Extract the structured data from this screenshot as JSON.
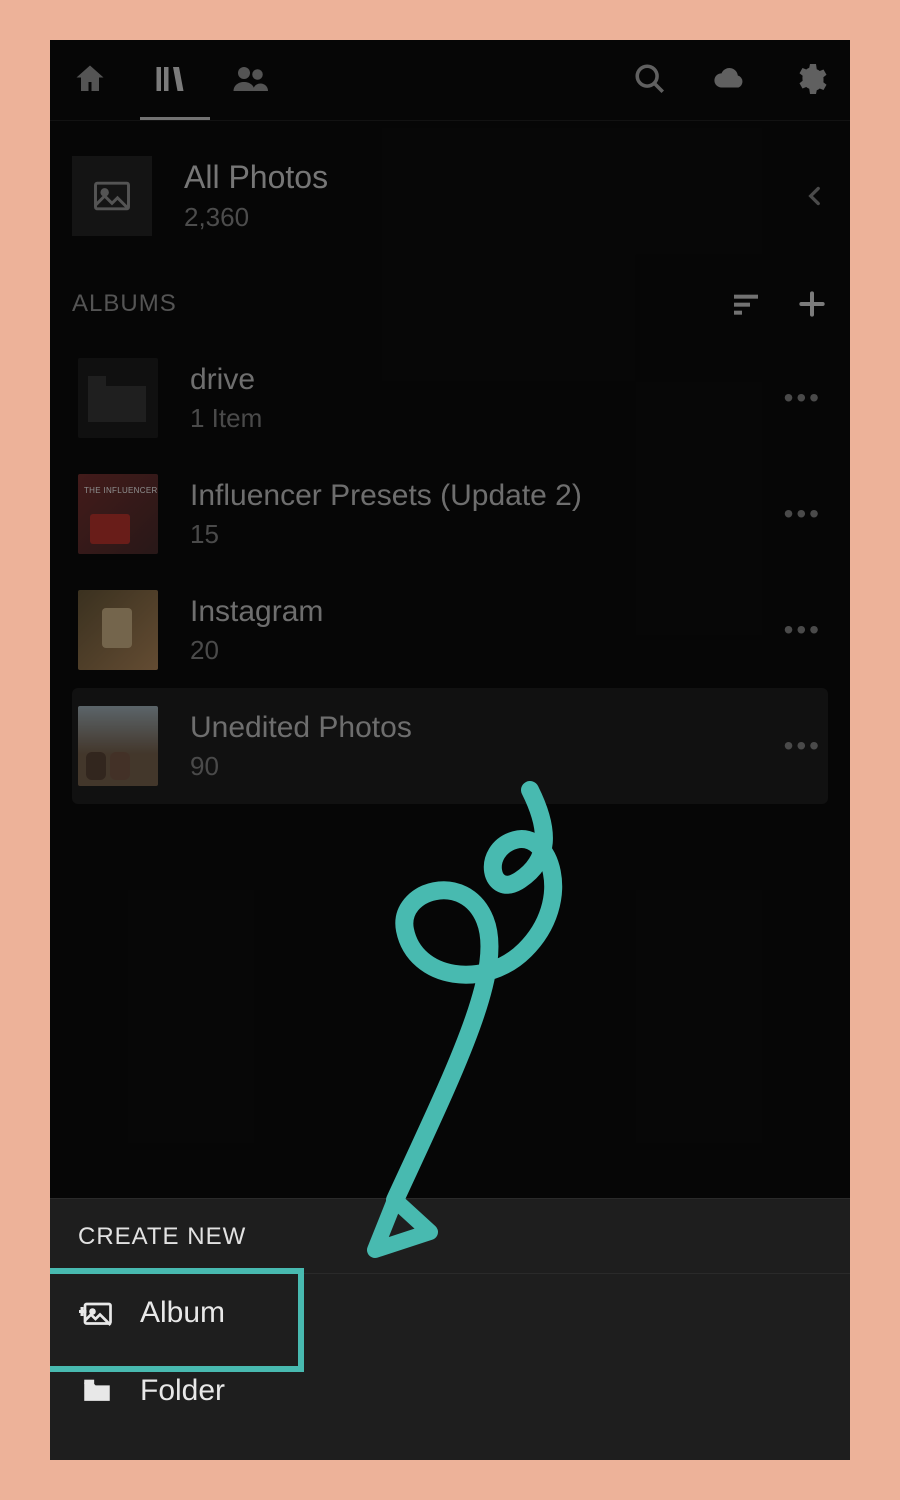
{
  "allPhotos": {
    "title": "All Photos",
    "count": "2,360"
  },
  "sections": {
    "albumsLabel": "ALBUMS"
  },
  "albums": [
    {
      "title": "drive",
      "count": "1 Item"
    },
    {
      "title": "Influencer Presets (Update 2)",
      "count": "15"
    },
    {
      "title": "Instagram",
      "count": "20"
    },
    {
      "title": "Unedited Photos",
      "count": "90"
    }
  ],
  "sheet": {
    "title": "CREATE NEW",
    "albumLabel": "Album",
    "folderLabel": "Folder"
  },
  "annotation": {
    "highlightColor": "#48bab0"
  }
}
